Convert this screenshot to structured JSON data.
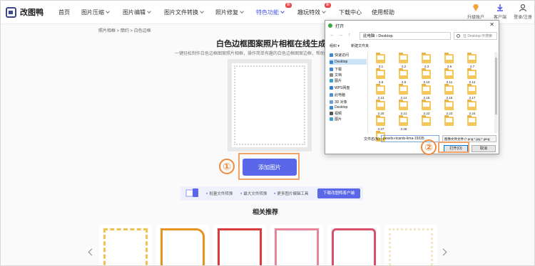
{
  "app": {
    "name": "改图鸭"
  },
  "nav": {
    "items": [
      {
        "label": "首页"
      },
      {
        "label": "图片压缩",
        "chevron": true
      },
      {
        "label": "图片编辑",
        "chevron": true
      },
      {
        "label": "图片文件转换",
        "chevron": true
      },
      {
        "label": "照片修复",
        "chevron": true
      },
      {
        "label": "特色功能",
        "chevron": true,
        "active": true,
        "badge": "新"
      },
      {
        "label": "趣玩特效",
        "chevron": true,
        "badge": "新"
      },
      {
        "label": "下载中心"
      },
      {
        "label": "使用帮助"
      }
    ],
    "tools": [
      {
        "label": "升级账户",
        "icon": "diamond-icon"
      },
      {
        "label": "客户端",
        "icon": "download-icon"
      },
      {
        "label": "登录/注册",
        "icon": "user-icon"
      }
    ]
  },
  "breadcrumb": "照片相框  >  簡约  >  白色边框",
  "main": {
    "title": "白色边框图案照片相框在线生成器",
    "subtitle": "一键轻松制作白色边框图案照片相框，操作简单有趣的白色边框图案边框，帮助您炮成漂亮的",
    "add_button": "添加图片"
  },
  "features": {
    "items": [
      "批量文件转换",
      "最大文件转换",
      "更多图片编辑工具"
    ],
    "download_button": "下载改图鸭客户端"
  },
  "related": {
    "title": "相关推荐"
  },
  "thumbnails": [
    {
      "color": "#f2c14e"
    },
    {
      "color": "#e5951f"
    },
    {
      "color": "#d93a3a"
    },
    {
      "color": "#e8859b"
    },
    {
      "color": "#d94f6b"
    },
    {
      "color": "#f3e6c8"
    }
  ],
  "annotations": {
    "step1": "①",
    "step2": "②"
  },
  "dialog": {
    "title": "打开",
    "close": "✕",
    "nav_glyphs": [
      "←",
      "→",
      "↑"
    ],
    "path": [
      "此电脑",
      "Desktop"
    ],
    "search_placeholder": "在 Desktop 中搜索",
    "organize": "组织 ▾",
    "new_folder": "新建文件夹",
    "sidebar": [
      {
        "label": "快速访问",
        "icon": "star-icon"
      },
      {
        "label": "Desktop",
        "icon": "desktop-icon",
        "selected": true
      },
      {
        "label": "下载",
        "icon": "download-icon"
      },
      {
        "label": "文档",
        "icon": "document-icon"
      },
      {
        "label": "图片",
        "icon": "picture-icon"
      },
      {
        "label": "WPS网盘",
        "icon": "cloud-icon"
      },
      {
        "label": "此电脑",
        "icon": "computer-icon"
      },
      {
        "label": "3D 对象",
        "icon": "cube-icon"
      },
      {
        "label": "Desktop",
        "icon": "desktop-icon"
      },
      {
        "label": "视频",
        "icon": "video-icon"
      },
      {
        "label": "图片",
        "icon": "picture-icon"
      }
    ],
    "folders": [
      "2.1",
      "2.2",
      "2.3",
      "2.6",
      "2.7",
      "2.8",
      "2.9",
      "2.10",
      "2.11",
      "2.12",
      "2.13",
      "2.14",
      "2.15",
      "2.16",
      "2.17",
      "2.20",
      "2.21",
      "2.22",
      "2.23",
      "2.24",
      "2.27",
      "2.28",
      "",
      "",
      "",
      ""
    ],
    "filename_label": "文件名(N):",
    "filename_value": "pexels-ricardo-lima-15035",
    "filter": "图像文件文件 (*.png;*.jpg;*.jpeg;",
    "open_button": "打开(O)",
    "cancel_button": "取消"
  },
  "colors": {
    "accent": "#5a67e8",
    "annotation": "#f08a3c"
  }
}
